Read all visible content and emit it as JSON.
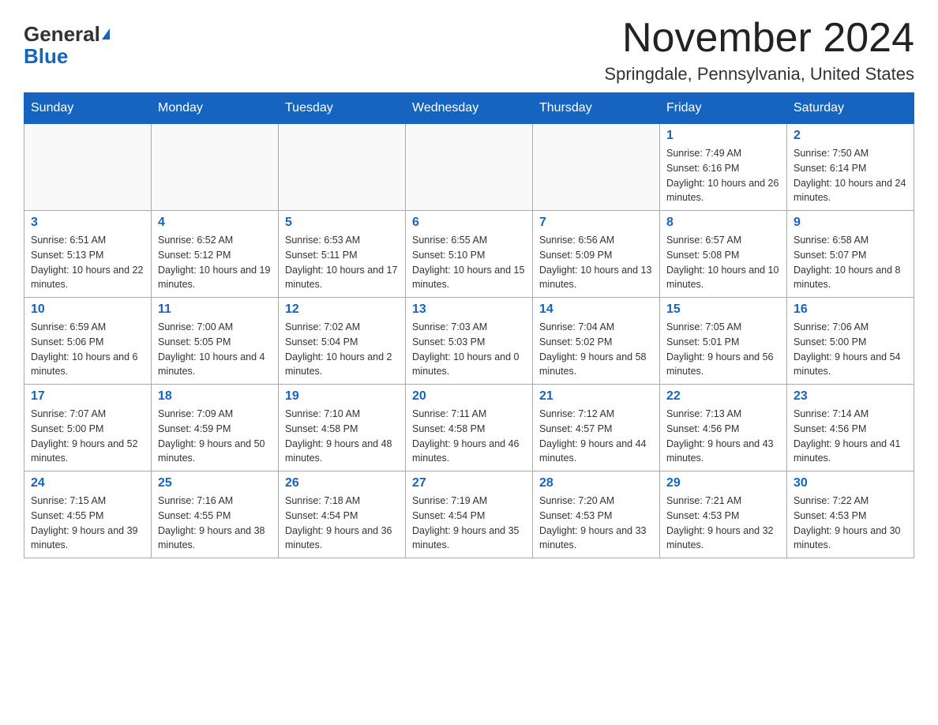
{
  "header": {
    "logo_general": "General",
    "logo_blue": "Blue",
    "month_title": "November 2024",
    "location": "Springdale, Pennsylvania, United States"
  },
  "days_of_week": [
    "Sunday",
    "Monday",
    "Tuesday",
    "Wednesday",
    "Thursday",
    "Friday",
    "Saturday"
  ],
  "weeks": [
    [
      {
        "day": "",
        "info": ""
      },
      {
        "day": "",
        "info": ""
      },
      {
        "day": "",
        "info": ""
      },
      {
        "day": "",
        "info": ""
      },
      {
        "day": "",
        "info": ""
      },
      {
        "day": "1",
        "info": "Sunrise: 7:49 AM\nSunset: 6:16 PM\nDaylight: 10 hours and 26 minutes."
      },
      {
        "day": "2",
        "info": "Sunrise: 7:50 AM\nSunset: 6:14 PM\nDaylight: 10 hours and 24 minutes."
      }
    ],
    [
      {
        "day": "3",
        "info": "Sunrise: 6:51 AM\nSunset: 5:13 PM\nDaylight: 10 hours and 22 minutes."
      },
      {
        "day": "4",
        "info": "Sunrise: 6:52 AM\nSunset: 5:12 PM\nDaylight: 10 hours and 19 minutes."
      },
      {
        "day": "5",
        "info": "Sunrise: 6:53 AM\nSunset: 5:11 PM\nDaylight: 10 hours and 17 minutes."
      },
      {
        "day": "6",
        "info": "Sunrise: 6:55 AM\nSunset: 5:10 PM\nDaylight: 10 hours and 15 minutes."
      },
      {
        "day": "7",
        "info": "Sunrise: 6:56 AM\nSunset: 5:09 PM\nDaylight: 10 hours and 13 minutes."
      },
      {
        "day": "8",
        "info": "Sunrise: 6:57 AM\nSunset: 5:08 PM\nDaylight: 10 hours and 10 minutes."
      },
      {
        "day": "9",
        "info": "Sunrise: 6:58 AM\nSunset: 5:07 PM\nDaylight: 10 hours and 8 minutes."
      }
    ],
    [
      {
        "day": "10",
        "info": "Sunrise: 6:59 AM\nSunset: 5:06 PM\nDaylight: 10 hours and 6 minutes."
      },
      {
        "day": "11",
        "info": "Sunrise: 7:00 AM\nSunset: 5:05 PM\nDaylight: 10 hours and 4 minutes."
      },
      {
        "day": "12",
        "info": "Sunrise: 7:02 AM\nSunset: 5:04 PM\nDaylight: 10 hours and 2 minutes."
      },
      {
        "day": "13",
        "info": "Sunrise: 7:03 AM\nSunset: 5:03 PM\nDaylight: 10 hours and 0 minutes."
      },
      {
        "day": "14",
        "info": "Sunrise: 7:04 AM\nSunset: 5:02 PM\nDaylight: 9 hours and 58 minutes."
      },
      {
        "day": "15",
        "info": "Sunrise: 7:05 AM\nSunset: 5:01 PM\nDaylight: 9 hours and 56 minutes."
      },
      {
        "day": "16",
        "info": "Sunrise: 7:06 AM\nSunset: 5:00 PM\nDaylight: 9 hours and 54 minutes."
      }
    ],
    [
      {
        "day": "17",
        "info": "Sunrise: 7:07 AM\nSunset: 5:00 PM\nDaylight: 9 hours and 52 minutes."
      },
      {
        "day": "18",
        "info": "Sunrise: 7:09 AM\nSunset: 4:59 PM\nDaylight: 9 hours and 50 minutes."
      },
      {
        "day": "19",
        "info": "Sunrise: 7:10 AM\nSunset: 4:58 PM\nDaylight: 9 hours and 48 minutes."
      },
      {
        "day": "20",
        "info": "Sunrise: 7:11 AM\nSunset: 4:58 PM\nDaylight: 9 hours and 46 minutes."
      },
      {
        "day": "21",
        "info": "Sunrise: 7:12 AM\nSunset: 4:57 PM\nDaylight: 9 hours and 44 minutes."
      },
      {
        "day": "22",
        "info": "Sunrise: 7:13 AM\nSunset: 4:56 PM\nDaylight: 9 hours and 43 minutes."
      },
      {
        "day": "23",
        "info": "Sunrise: 7:14 AM\nSunset: 4:56 PM\nDaylight: 9 hours and 41 minutes."
      }
    ],
    [
      {
        "day": "24",
        "info": "Sunrise: 7:15 AM\nSunset: 4:55 PM\nDaylight: 9 hours and 39 minutes."
      },
      {
        "day": "25",
        "info": "Sunrise: 7:16 AM\nSunset: 4:55 PM\nDaylight: 9 hours and 38 minutes."
      },
      {
        "day": "26",
        "info": "Sunrise: 7:18 AM\nSunset: 4:54 PM\nDaylight: 9 hours and 36 minutes."
      },
      {
        "day": "27",
        "info": "Sunrise: 7:19 AM\nSunset: 4:54 PM\nDaylight: 9 hours and 35 minutes."
      },
      {
        "day": "28",
        "info": "Sunrise: 7:20 AM\nSunset: 4:53 PM\nDaylight: 9 hours and 33 minutes."
      },
      {
        "day": "29",
        "info": "Sunrise: 7:21 AM\nSunset: 4:53 PM\nDaylight: 9 hours and 32 minutes."
      },
      {
        "day": "30",
        "info": "Sunrise: 7:22 AM\nSunset: 4:53 PM\nDaylight: 9 hours and 30 minutes."
      }
    ]
  ]
}
